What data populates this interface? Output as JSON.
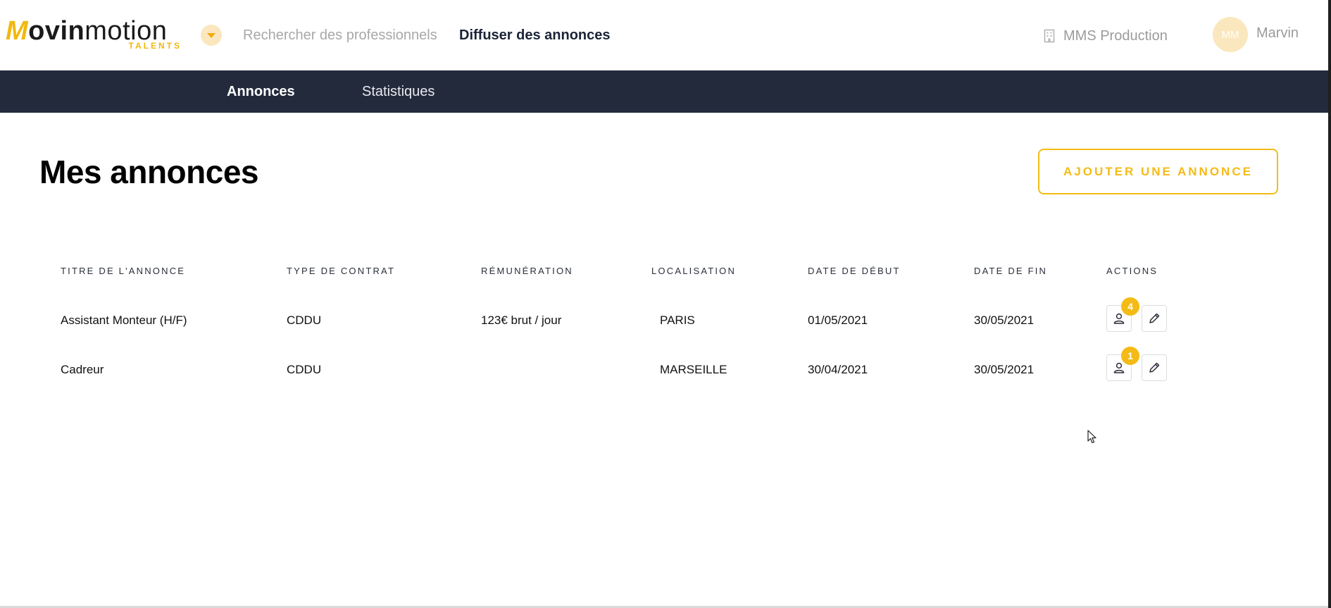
{
  "brand": {
    "logo_mark": "M",
    "logo_bold": "ovin",
    "logo_light": "motion",
    "logo_sub": "TALENTS",
    "accent": "#f4bb16",
    "navy": "#222a3c"
  },
  "topnav": {
    "toggle_icon": "chevron-down-icon",
    "links": [
      {
        "label": "Rechercher des professionnels",
        "active": false
      },
      {
        "label": "Diffuser des annonces",
        "active": true
      }
    ],
    "company": {
      "icon": "building-icon",
      "name": "MMS Production"
    },
    "user": {
      "initials": "MM",
      "name": "Marvin"
    }
  },
  "subnav": {
    "tabs": [
      {
        "label": "Annonces",
        "active": true
      },
      {
        "label": "Statistiques",
        "active": false
      }
    ]
  },
  "page": {
    "title": "Mes annonces",
    "add_button": "AJOUTER UNE ANNONCE"
  },
  "table": {
    "headers": [
      "TITRE DE L'ANNONCE",
      "TYPE DE CONTRAT",
      "RÉMUNÉRATION",
      "LOCALISATION",
      "DATE DE DÉBUT",
      "DATE DE FIN",
      "ACTIONS"
    ],
    "rows": [
      {
        "title": "Assistant Monteur (H/F)",
        "contract": "CDDU",
        "pay": "123€ brut / jour",
        "location": "PARIS",
        "start": "01/05/2021",
        "end": "30/05/2021",
        "candidates": "4"
      },
      {
        "title": "Cadreur",
        "contract": "CDDU",
        "pay": "",
        "location": "MARSEILLE",
        "start": "30/04/2021",
        "end": "30/05/2021",
        "candidates": "1"
      }
    ],
    "action_icons": [
      "user-icon",
      "pencil-icon"
    ]
  }
}
